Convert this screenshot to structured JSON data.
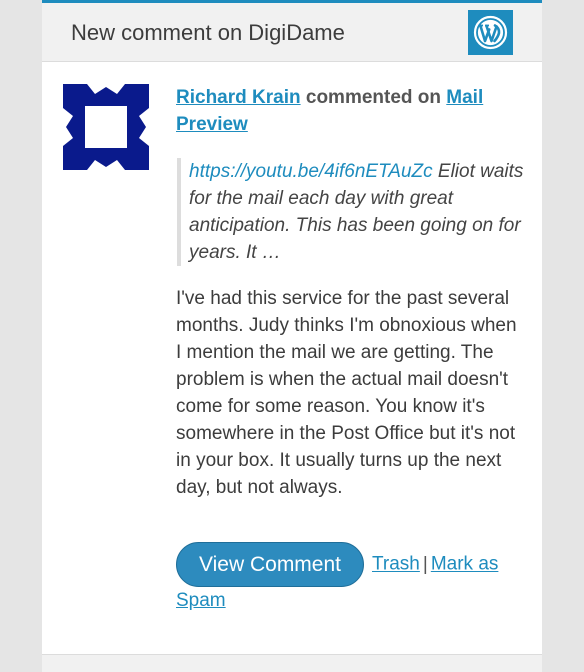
{
  "header": {
    "title": "New comment on DigiDame",
    "logo_icon": "wordpress-logo-icon"
  },
  "comment": {
    "author": "Richard Krain",
    "action_text": " commented on ",
    "post_title": "Mail Preview",
    "quote_link": "https://youtu.be/4if6nETAuZc",
    "quote_text": " Eliot waits for the mail each day with great anticipation. This has been going on for years. It …",
    "body": "I've had this service for the past several months. Judy thinks I'm obnoxious when I mention the mail we are getting. The problem is when the actual mail doesn't come for some reason. You know it's somewhere in the Post Office but it's not in your box. It usually turns up the next day, but not always."
  },
  "actions": {
    "view_label": "View Comment",
    "trash_label": "Trash",
    "separator": "|",
    "spam_label": "Mark as Spam"
  },
  "colors": {
    "accent": "#1e8cbe",
    "avatar": "#0a1a8c",
    "gutter": "#e5e5e5"
  }
}
